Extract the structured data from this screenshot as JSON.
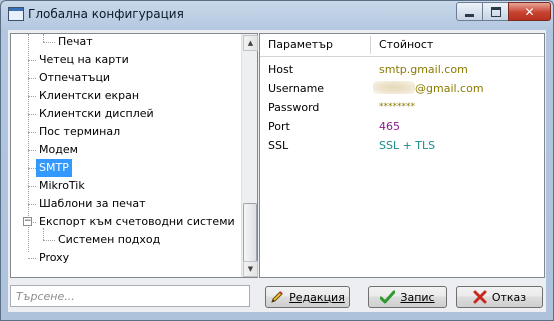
{
  "window": {
    "title": "Глобална конфигурация",
    "close_glyph": "✕"
  },
  "tree": {
    "items": [
      {
        "label": "Печат",
        "level": 2
      },
      {
        "label": "Четец на карти",
        "level": 1
      },
      {
        "label": "Отпечатъци",
        "level": 1
      },
      {
        "label": "Клиентски екран",
        "level": 1
      },
      {
        "label": "Клиентски дисплей",
        "level": 1
      },
      {
        "label": "Пос терминал",
        "level": 1
      },
      {
        "label": "Модем",
        "level": 1
      },
      {
        "label": "SMTP",
        "level": 1,
        "selected": true
      },
      {
        "label": "MikroTik",
        "level": 1
      },
      {
        "label": "Шаблони за печат",
        "level": 1
      },
      {
        "label": "Експорт към счетоводни системи",
        "level": 1,
        "expanded": true
      },
      {
        "label": "Системен подход",
        "level": 2
      },
      {
        "label": "Proxy",
        "level": 1
      }
    ],
    "collapse_glyph": "−"
  },
  "properties": {
    "headers": {
      "name": "Параметър",
      "value": "Стойност"
    },
    "rows": [
      {
        "name": "Host",
        "value": "smtp.gmail.com"
      },
      {
        "name": "Username",
        "value": "@gmail.com"
      },
      {
        "name": "Password",
        "value": "********"
      },
      {
        "name": "Port",
        "value": "465"
      },
      {
        "name": "SSL",
        "value": "SSL + TLS"
      }
    ]
  },
  "search": {
    "placeholder": "Търсене..."
  },
  "buttons": {
    "edit": {
      "label": "Редакция",
      "icon": "pencil-icon"
    },
    "save": {
      "label": "Запис",
      "icon": "checkmark-icon",
      "color": "#2e9a2e"
    },
    "cancel": {
      "label": "Отказ",
      "icon": "x-icon",
      "color": "#c8281e"
    }
  }
}
